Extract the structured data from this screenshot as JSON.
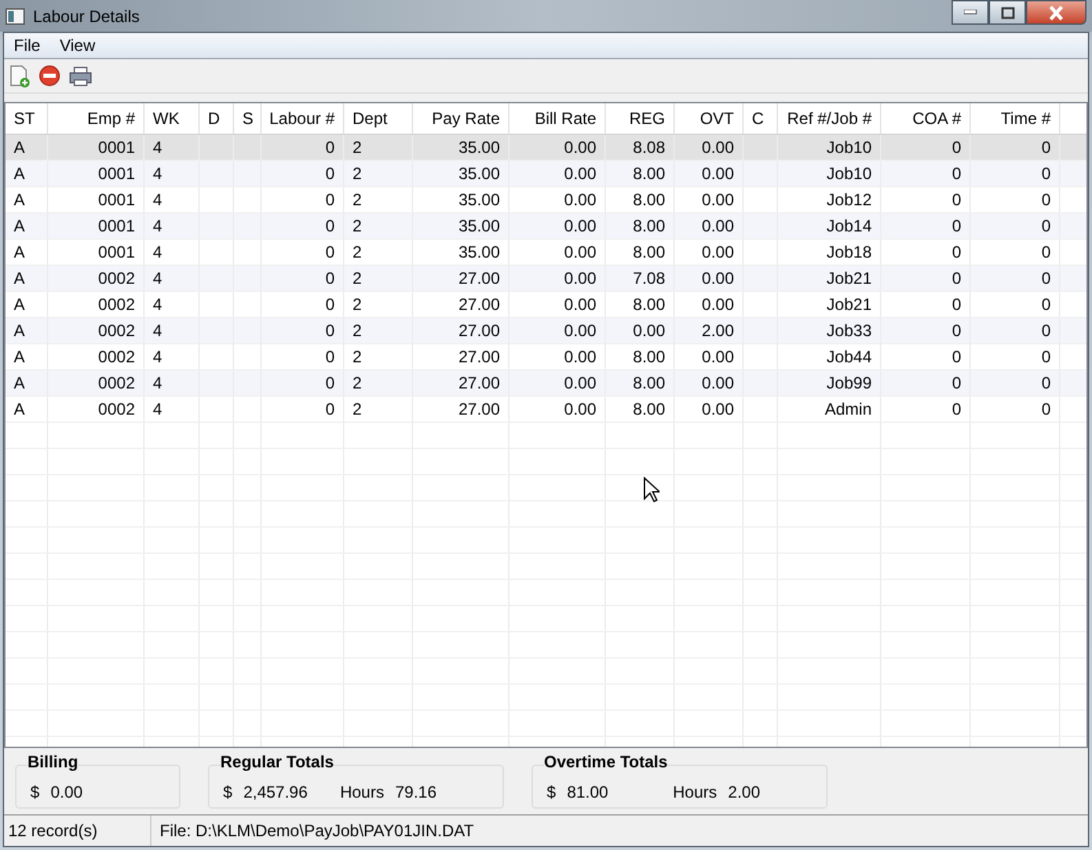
{
  "window": {
    "title": "Labour Details"
  },
  "menu": [
    "File",
    "View"
  ],
  "table": {
    "columns": [
      "ST",
      "Emp #",
      "WK",
      "D",
      "S",
      "Labour #",
      "Dept",
      "Pay Rate",
      "Bill Rate",
      "REG",
      "OVT",
      "C",
      "Ref #/Job #",
      "COA #",
      "Time #"
    ],
    "rows": [
      {
        "selected": true,
        "cells": [
          "A",
          "0001",
          "4",
          "",
          "",
          "0",
          "2",
          "35.00",
          "0.00",
          "8.08",
          "0.00",
          "",
          "Job10",
          "0",
          "0"
        ]
      },
      {
        "selected": false,
        "cells": [
          "A",
          "0001",
          "4",
          "",
          "",
          "0",
          "2",
          "35.00",
          "0.00",
          "8.00",
          "0.00",
          "",
          "Job10",
          "0",
          "0"
        ]
      },
      {
        "selected": false,
        "cells": [
          "A",
          "0001",
          "4",
          "",
          "",
          "0",
          "2",
          "35.00",
          "0.00",
          "8.00",
          "0.00",
          "",
          "Job12",
          "0",
          "0"
        ]
      },
      {
        "selected": false,
        "cells": [
          "A",
          "0001",
          "4",
          "",
          "",
          "0",
          "2",
          "35.00",
          "0.00",
          "8.00",
          "0.00",
          "",
          "Job14",
          "0",
          "0"
        ]
      },
      {
        "selected": false,
        "cells": [
          "A",
          "0001",
          "4",
          "",
          "",
          "0",
          "2",
          "35.00",
          "0.00",
          "8.00",
          "0.00",
          "",
          "Job18",
          "0",
          "0"
        ]
      },
      {
        "selected": false,
        "cells": [
          "A",
          "0002",
          "4",
          "",
          "",
          "0",
          "2",
          "27.00",
          "0.00",
          "7.08",
          "0.00",
          "",
          "Job21",
          "0",
          "0"
        ]
      },
      {
        "selected": false,
        "cells": [
          "A",
          "0002",
          "4",
          "",
          "",
          "0",
          "2",
          "27.00",
          "0.00",
          "8.00",
          "0.00",
          "",
          "Job21",
          "0",
          "0"
        ]
      },
      {
        "selected": false,
        "cells": [
          "A",
          "0002",
          "4",
          "",
          "",
          "0",
          "2",
          "27.00",
          "0.00",
          "0.00",
          "2.00",
          "",
          "Job33",
          "0",
          "0"
        ]
      },
      {
        "selected": false,
        "cells": [
          "A",
          "0002",
          "4",
          "",
          "",
          "0",
          "2",
          "27.00",
          "0.00",
          "8.00",
          "0.00",
          "",
          "Job44",
          "0",
          "0"
        ]
      },
      {
        "selected": false,
        "cells": [
          "A",
          "0002",
          "4",
          "",
          "",
          "0",
          "2",
          "27.00",
          "0.00",
          "8.00",
          "0.00",
          "",
          "Job99",
          "0",
          "0"
        ]
      },
      {
        "selected": false,
        "cells": [
          "A",
          "0002",
          "4",
          "",
          "",
          "0",
          "2",
          "27.00",
          "0.00",
          "8.00",
          "0.00",
          "",
          "Admin",
          "0",
          "0"
        ]
      }
    ]
  },
  "totals": [
    {
      "title": "Billing",
      "currency": "$",
      "amount": "0.00"
    },
    {
      "title": "Regular Totals",
      "currency": "$",
      "amount": "2,457.96",
      "hours_label": "Hours",
      "hours": "79.16"
    },
    {
      "title": "Overtime Totals",
      "currency": "$",
      "amount": "81.00",
      "hours_label": "Hours",
      "hours": "2.00"
    }
  ],
  "status_bar": {
    "records": "12 record(s)",
    "file": "File: D:\\KLM\\Demo\\PayJob\\PAY01JIN.DAT"
  }
}
